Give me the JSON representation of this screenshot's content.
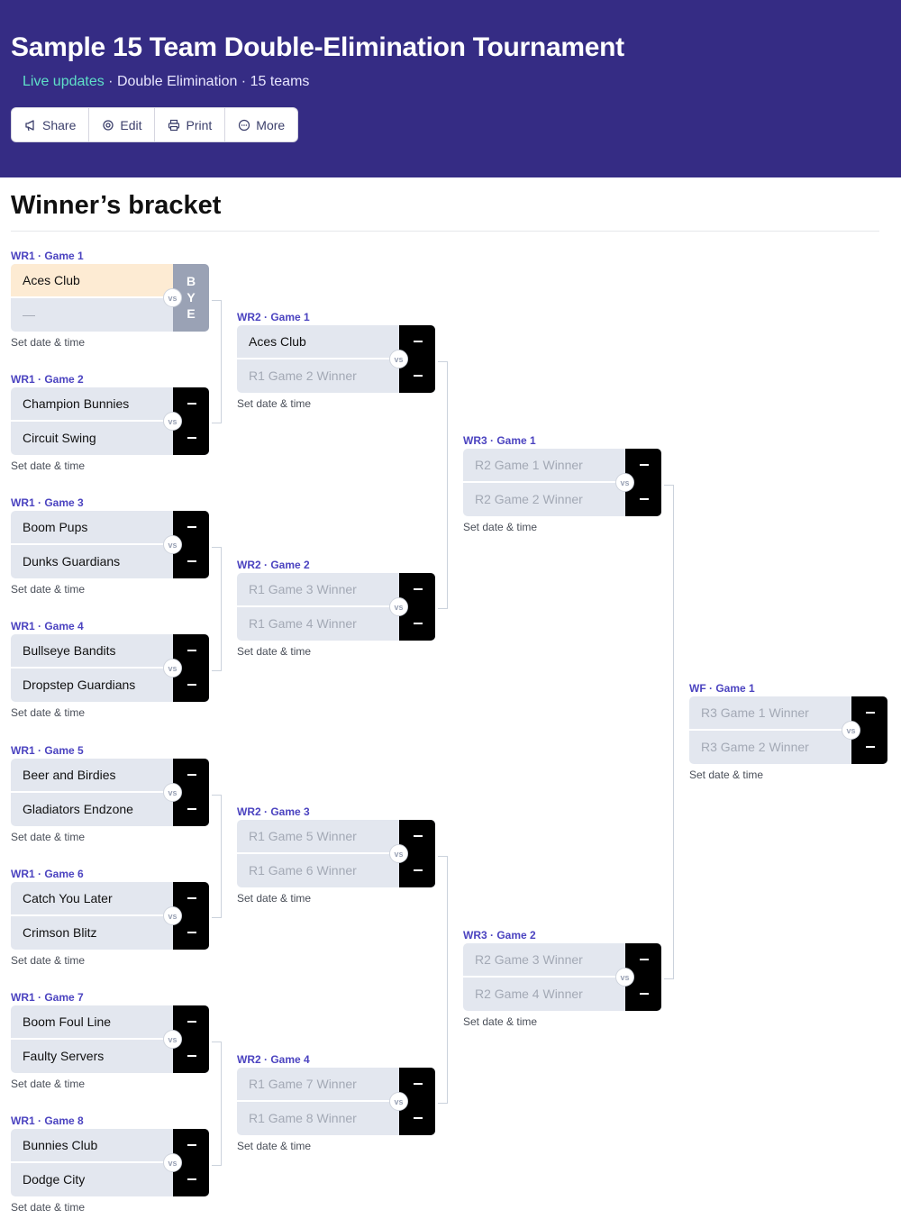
{
  "header": {
    "title": "Sample 15 Team Double-Elimination Tournament",
    "live": "Live updates",
    "meta": " · Double Elimination · 15 teams"
  },
  "toolbar": {
    "share": "Share",
    "edit": "Edit",
    "print": "Print",
    "more": "More"
  },
  "section": {
    "title": "Winner’s bracket"
  },
  "vs_label": "vs",
  "bye_label": "B\nY\nE",
  "datetime_label": "Set date & time",
  "games": {
    "r1g1": {
      "label": "WR1 · Game 1",
      "team1": "Aces Club",
      "team2": "—"
    },
    "r1g2": {
      "label": "WR1 · Game 2",
      "team1": "Champion Bunnies",
      "team2": "Circuit Swing"
    },
    "r1g3": {
      "label": "WR1 · Game 3",
      "team1": "Boom Pups",
      "team2": "Dunks Guardians"
    },
    "r1g4": {
      "label": "WR1 · Game 4",
      "team1": "Bullseye Bandits",
      "team2": "Dropstep Guardians"
    },
    "r1g5": {
      "label": "WR1 · Game 5",
      "team1": "Beer and Birdies",
      "team2": "Gladiators Endzone"
    },
    "r1g6": {
      "label": "WR1 · Game 6",
      "team1": "Catch You Later",
      "team2": "Crimson Blitz"
    },
    "r1g7": {
      "label": "WR1 · Game 7",
      "team1": "Boom Foul Line",
      "team2": "Faulty Servers"
    },
    "r1g8": {
      "label": "WR1 · Game 8",
      "team1": "Bunnies Club",
      "team2": "Dodge City"
    },
    "r2g1": {
      "label": "WR2 · Game 1",
      "team1": "Aces Club",
      "team2": "R1 Game 2 Winner"
    },
    "r2g2": {
      "label": "WR2 · Game 2",
      "team1": "R1 Game 3 Winner",
      "team2": "R1 Game 4 Winner"
    },
    "r2g3": {
      "label": "WR2 · Game 3",
      "team1": "R1 Game 5 Winner",
      "team2": "R1 Game 6 Winner"
    },
    "r2g4": {
      "label": "WR2 · Game 4",
      "team1": "R1 Game 7 Winner",
      "team2": "R1 Game 8 Winner"
    },
    "r3g1": {
      "label": "WR3 · Game 1",
      "team1": "R2 Game 1 Winner",
      "team2": "R2 Game 2 Winner"
    },
    "r3g2": {
      "label": "WR3 · Game 2",
      "team1": "R2 Game 3 Winner",
      "team2": "R2 Game 4 Winner"
    },
    "wfg1": {
      "label": "WF · Game 1",
      "team1": "R3 Game 1 Winner",
      "team2": "R3 Game 2 Winner"
    }
  },
  "colors": {
    "header_bg": "#352c84",
    "accent": "#4b43c0",
    "live": "#5fe0c8",
    "highlight": "#fdebd3",
    "score_box": "#000000",
    "bye_box": "#9aa2b5"
  },
  "icons": {
    "share": "megaphone-icon",
    "edit": "gear-icon",
    "print": "printer-icon",
    "more": "more-icon"
  }
}
